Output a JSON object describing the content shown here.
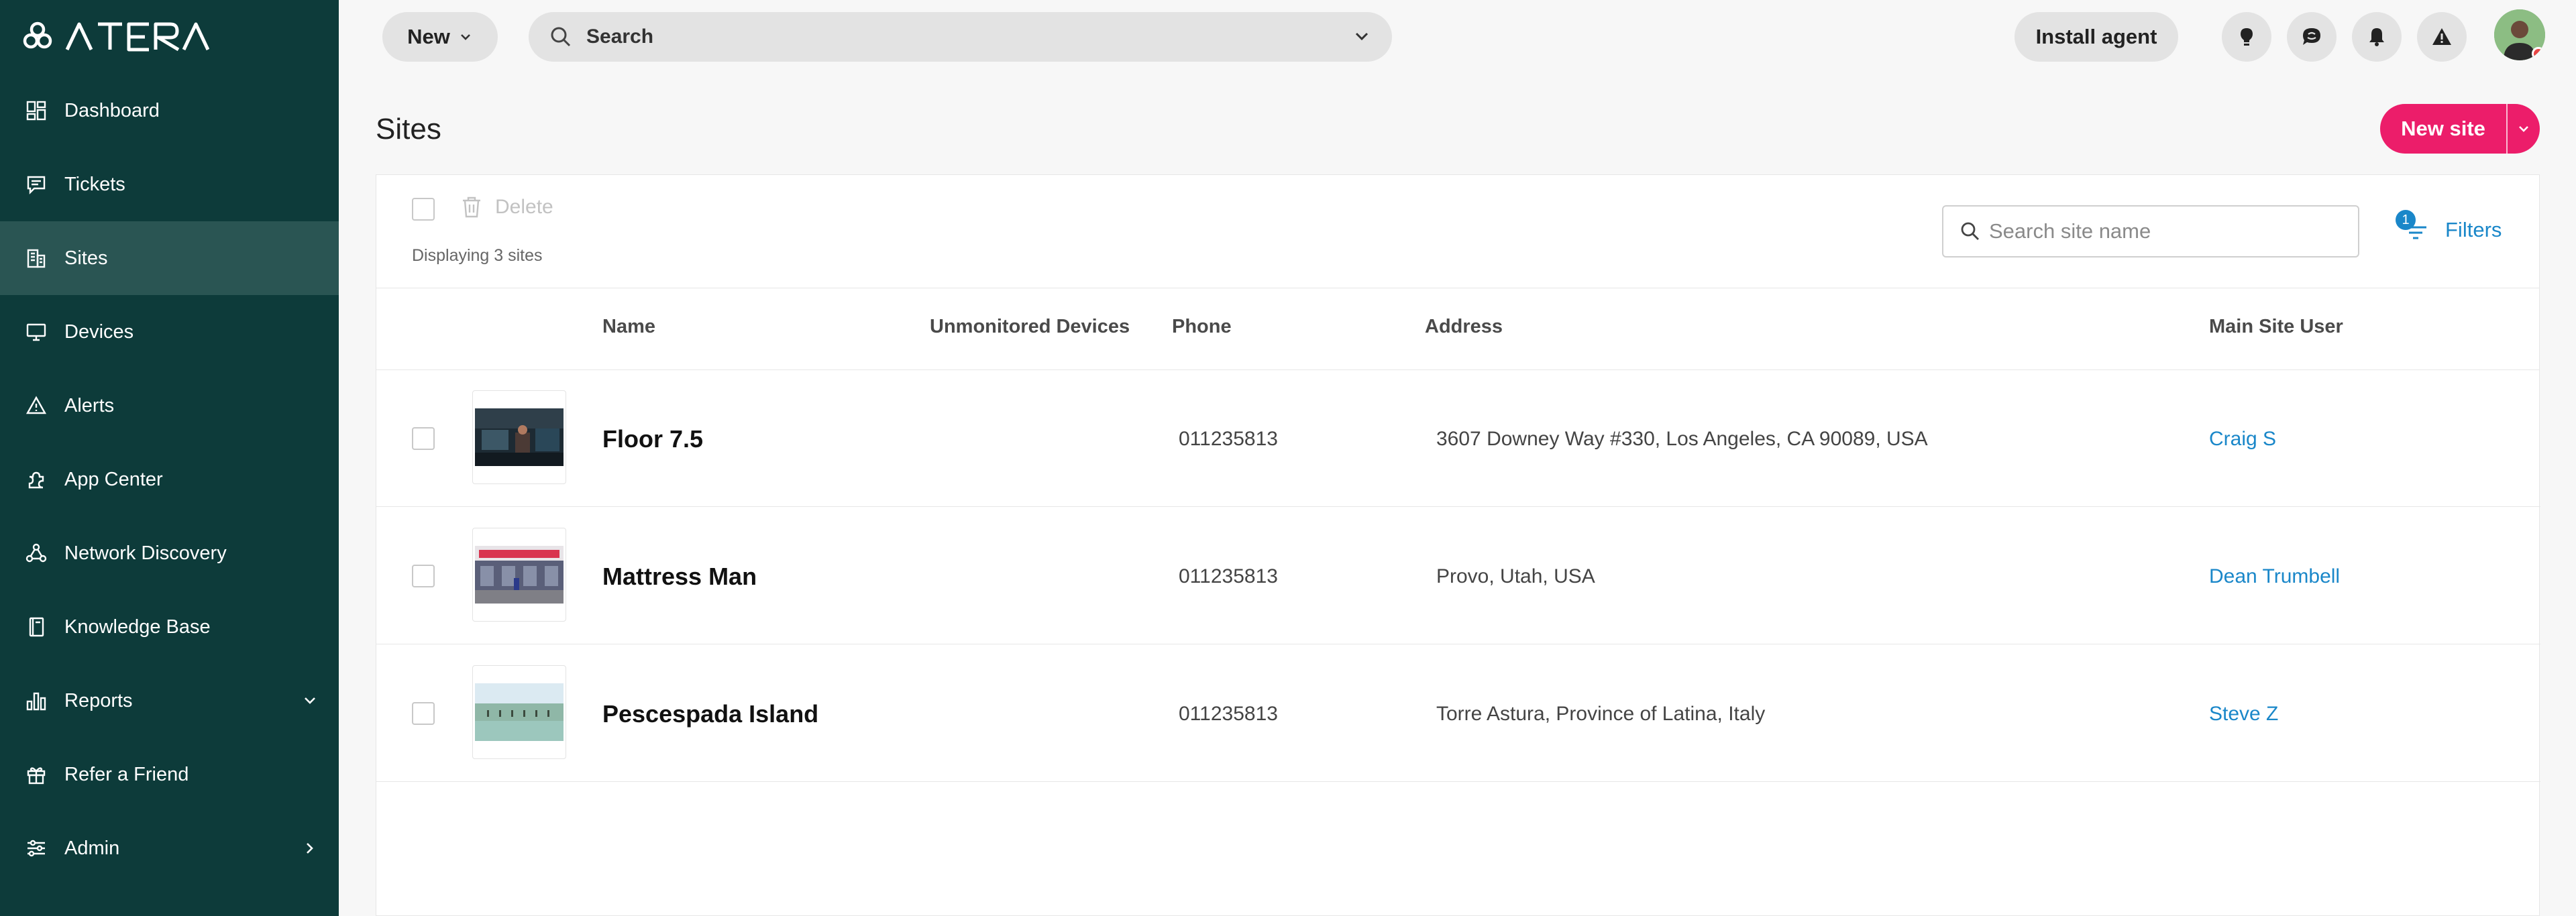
{
  "brand": {
    "logo_text": "ATERA"
  },
  "sidebar": {
    "items": [
      {
        "label": "Dashboard",
        "icon": "dashboard-icon"
      },
      {
        "label": "Tickets",
        "icon": "tickets-icon"
      },
      {
        "label": "Sites",
        "icon": "sites-icon",
        "active": true
      },
      {
        "label": "Devices",
        "icon": "devices-icon"
      },
      {
        "label": "Alerts",
        "icon": "alerts-icon"
      },
      {
        "label": "App Center",
        "icon": "app-center-icon"
      },
      {
        "label": "Network Discovery",
        "icon": "network-discovery-icon"
      },
      {
        "label": "Knowledge Base",
        "icon": "knowledge-base-icon"
      },
      {
        "label": "Reports",
        "icon": "reports-icon"
      },
      {
        "label": "Refer a Friend",
        "icon": "gift-icon"
      },
      {
        "label": "Admin",
        "icon": "admin-icon"
      }
    ]
  },
  "topbar": {
    "new_label": "New",
    "search_label": "Search",
    "install_label": "Install agent"
  },
  "page": {
    "title": "Sites",
    "new_site_label": "New site"
  },
  "toolbar": {
    "delete_label": "Delete",
    "displaying_text": "Displaying 3 sites",
    "search_placeholder": "Search site name",
    "filters_label": "Filters",
    "filters_count": "1"
  },
  "table": {
    "columns": [
      "Name",
      "Unmonitored Devices",
      "Phone",
      "Address",
      "Main Site User"
    ],
    "rows": [
      {
        "name": "Floor 7.5",
        "unmonitored": "",
        "phone": "011235813",
        "address": "3607 Downey Way #330, Los Angeles, CA 90089, USA",
        "user": "Craig S"
      },
      {
        "name": "Mattress Man",
        "unmonitored": "",
        "phone": "011235813",
        "address": "Provo, Utah, USA",
        "user": "Dean Trumbell"
      },
      {
        "name": "Pescespada Island",
        "unmonitored": "",
        "phone": "011235813",
        "address": "Torre Astura, Province of Latina, Italy",
        "user": "Steve Z"
      }
    ]
  },
  "colors": {
    "sidebar_bg": "#0d3b3a",
    "sidebar_active": "#2a5553",
    "accent_pink": "#ec1d6a",
    "link_blue": "#1a87c9"
  }
}
